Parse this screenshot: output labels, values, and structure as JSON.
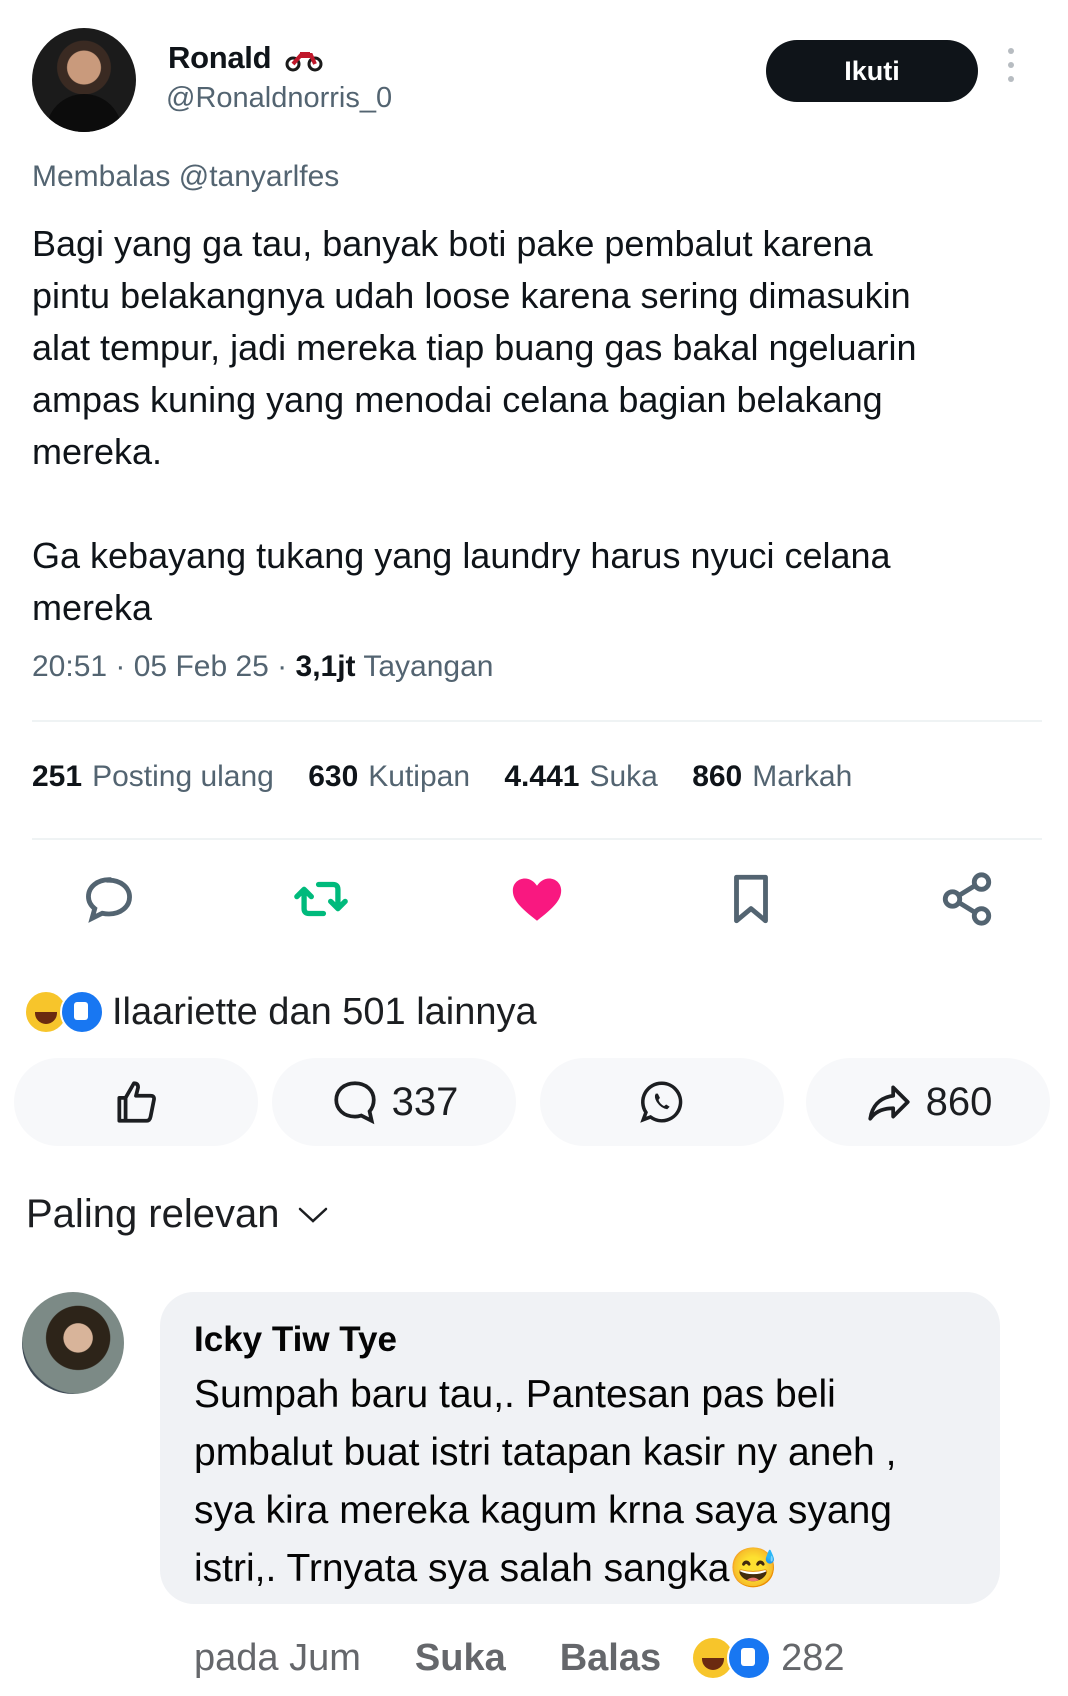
{
  "tweet": {
    "author_name": "Ronald",
    "handle": "@Ronaldnorris_0",
    "follow_label": "Ikuti",
    "reply_prefix": "Membalas",
    "reply_mention": "@tanyarlfes",
    "text": "Bagi yang ga tau, banyak boti pake pembalut karena\npintu belakangnya udah loose karena sering dimasukin\nalat tempur, jadi mereka tiap buang gas bakal ngeluarin\nampas kuning yang menodai celana bagian belakang\nmereka.\n\nGa kebayang tukang yang laundry harus nyuci celana\nmereka",
    "time": "20:51 · 05 Feb 25 ·",
    "views_count": "3,1jt",
    "views_label": "Tayangan",
    "stats": [
      {
        "count": "251",
        "label": "Posting ulang"
      },
      {
        "count": "630",
        "label": "Kutipan"
      },
      {
        "count": "4.441",
        "label": "Suka"
      },
      {
        "count": "860",
        "label": "Markah"
      }
    ],
    "colors": {
      "retweet": "#00ba7c",
      "like": "#f91880",
      "icon": "#536471"
    }
  },
  "facebook": {
    "reactors_text": "Ilaariette dan 501 lainnya",
    "comment_count": "337",
    "share_count": "860",
    "sort_label": "Paling relevan"
  },
  "comment": {
    "author": "Icky Tiw Tye",
    "text": "Sumpah baru tau,. Pantesan pas beli\npmbalut buat istri tatapan kasir ny aneh ,\nsya kira mereka kagum krna saya syang\nistri,. Trnyata sya salah sangka😅",
    "time": "pada Jum",
    "like_label": "Suka",
    "reply_label": "Balas",
    "reaction_count": "282"
  }
}
